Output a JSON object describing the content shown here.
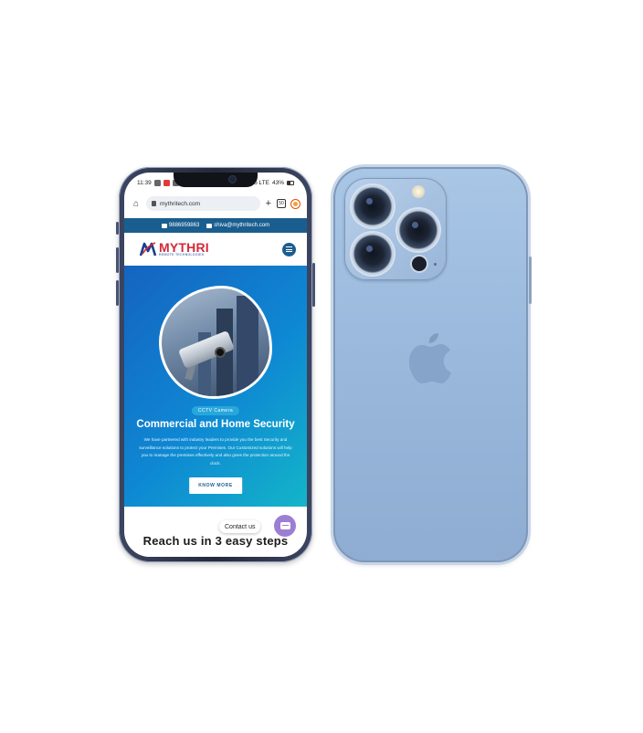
{
  "colors": {
    "accent_blue": "#1a5e8f",
    "hero_start": "#1564c0",
    "hero_end": "#14b5c9",
    "logo_red": "#d42a3a",
    "chat_purple": "#9c7fd2",
    "back_phone_blue": "#9ab9dc"
  },
  "status_bar": {
    "time": "11:39",
    "signal": "Vo LTE",
    "battery": "43%"
  },
  "browser": {
    "url": "mythritech.com",
    "tab_count": "50"
  },
  "info_bar": {
    "phone": "9886959863",
    "email": "shiva@mythritech.com"
  },
  "logo": {
    "name": "MYTHRI",
    "tagline": "REMOTE TECHNOLOGIES"
  },
  "hero": {
    "badge": "CCTV Camera",
    "title": "Commercial and Home Security",
    "description": "We have partnered with industry leaders to provide you the best Security and surveillance solutions to protect your Premises. Our Customized solutions will help you to manage the premises effectively and also gives the protection around the clock.",
    "button": "KNOW MORE"
  },
  "contact": {
    "label": "Contact us"
  },
  "section": {
    "heading": "Reach us in 3 easy steps"
  },
  "icons": [
    "home-icon",
    "lock-icon",
    "plus-icon",
    "tabs-icon",
    "menu-icon",
    "phone-icon",
    "mail-icon",
    "hamburger-icon",
    "chat-icon",
    "apple-logo-icon"
  ]
}
